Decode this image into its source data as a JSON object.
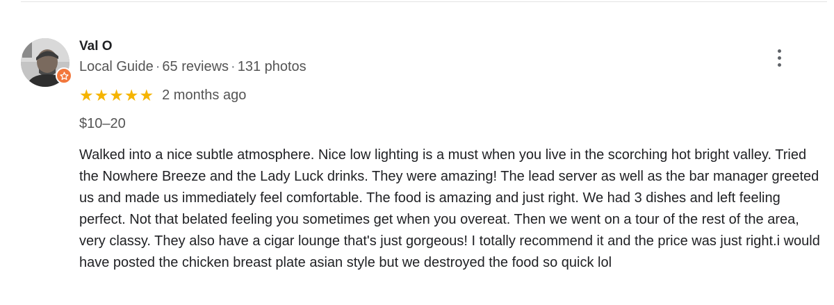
{
  "review": {
    "author": "Val O",
    "meta": {
      "badge": "Local Guide",
      "reviews": "65 reviews",
      "photos": "131 photos",
      "separator": "·"
    },
    "rating": 5,
    "star_glyph": "★",
    "time": "2 months ago",
    "price": "$10–20",
    "text": "Walked into a nice subtle atmosphere. Nice low lighting is a must when you live in the scorching hot bright valley. Tried the Nowhere Breeze and the Lady Luck drinks. They were amazing! The lead server as well as the bar manager greeted us and made us immediately feel comfortable. The food is amazing and just right. We had 3 dishes and left feeling perfect. Not that belated feeling you sometimes get when you overeat. Then we went on a tour of the rest of the area, very classy. They also have a cigar lounge that's just gorgeous! I totally recommend it and the price was just right.i would have posted the chicken breast plate asian style but we destroyed the food so quick lol"
  },
  "icons": {
    "avatar": "profile-photo",
    "badge": "local-guide-star-icon",
    "menu": "more-vert-icon"
  },
  "colors": {
    "star": "#f5b400",
    "badge": "#f2773c",
    "secondary_text": "#545454",
    "primary_text": "#202124"
  }
}
